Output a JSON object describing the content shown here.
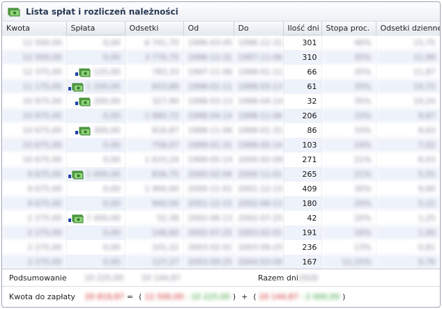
{
  "title": "Lista spłat i rozliczeń należności",
  "columns": [
    "Kwota",
    "Spłata",
    "Odsetki",
    "Od",
    "Do",
    "Ilość dni",
    "Stopa proc.",
    "Odsetki dzienne"
  ],
  "rows": [
    {
      "kwota": "12 500,00",
      "splata": "0,00",
      "payicon": false,
      "odsetki": "6 741,70",
      "od": "1996-03-05",
      "do": "1996-12-31",
      "dni": "301",
      "stopa": "46%",
      "dzienne": "15,75"
    },
    {
      "kwota": "12 500,00",
      "splata": "0,00",
      "payicon": false,
      "odsetki": "3 770,75",
      "od": "1996-12-31",
      "do": "1997-11-06",
      "dni": "310",
      "stopa": "35%",
      "dzienne": "11,99"
    },
    {
      "kwota": "12 375,00",
      "splata": "125,00",
      "payicon": true,
      "odsetki": "783,33",
      "od": "1997-11-06",
      "do": "1998-01-11",
      "dni": "66",
      "stopa": "35%",
      "dzienne": "11,87"
    },
    {
      "kwota": "11 175,00",
      "splata": "1 200,00",
      "payicon": true,
      "odsetki": "653,89",
      "od": "1998-01-11",
      "do": "1998-03-13",
      "dni": "61",
      "stopa": "35%",
      "dzienne": "10,72"
    },
    {
      "kwota": "10 975,00",
      "splata": "200,00",
      "payicon": true,
      "odsetki": "327,90",
      "od": "1998-03-13",
      "do": "1998-04-14",
      "dni": "32",
      "stopa": "35%",
      "dzienne": "10,24"
    },
    {
      "kwota": "10 975,00",
      "splata": "0,00",
      "payicon": false,
      "odsetki": "1 880,72",
      "od": "1998-04-14",
      "do": "1998-11-06",
      "dni": "206",
      "stopa": "33%",
      "dzienne": "9,87"
    },
    {
      "kwota": "10 675,00",
      "splata": "300,00",
      "payicon": true,
      "odsetki": "816,87",
      "od": "1998-11-06",
      "do": "1999-01-31",
      "dni": "86",
      "stopa": "33%",
      "dzienne": "9,63"
    },
    {
      "kwota": "10 675,00",
      "splata": "0,00",
      "payicon": false,
      "odsetki": "758,07",
      "od": "1999-01-31",
      "do": "1999-05-14",
      "dni": "103",
      "stopa": "24%",
      "dzienne": "7,02"
    },
    {
      "kwota": "10 675,00",
      "splata": "0,00",
      "payicon": false,
      "odsetki": "1 633,24",
      "od": "1999-05-14",
      "do": "2000-02-09",
      "dni": "271",
      "stopa": "21%",
      "dzienne": "6,03"
    },
    {
      "kwota": "9 675,00",
      "splata": "1 000,00",
      "payicon": true,
      "odsetki": "836,75",
      "od": "2000-02-09",
      "do": "2000-11-01",
      "dni": "265",
      "stopa": "21%",
      "dzienne": "5,55"
    },
    {
      "kwota": "9 675,00",
      "splata": "0,00",
      "payicon": false,
      "odsetki": "1 900,00",
      "od": "2000-11-01",
      "do": "2001-12-15",
      "dni": "409",
      "stopa": "30%",
      "dzienne": "9,90"
    },
    {
      "kwota": "9 675,00",
      "splata": "0,00",
      "payicon": false,
      "odsetki": "940,00",
      "od": "2001-12-15",
      "do": "2002-06-13",
      "dni": "180",
      "stopa": "20%",
      "dzienne": "5,22"
    },
    {
      "kwota": "2 275,00",
      "splata": "7 400,00",
      "payicon": true,
      "odsetki": "52,38",
      "od": "2002-06-13",
      "do": "2002-07-25",
      "dni": "42",
      "stopa": "20%",
      "dzienne": "1,25"
    },
    {
      "kwota": "2 275,00",
      "splata": "0,00",
      "payicon": false,
      "odsetki": "148,60",
      "od": "2002-07-25",
      "do": "2003-02-01",
      "dni": "191",
      "stopa": "16%",
      "dzienne": "1,00"
    },
    {
      "kwota": "2 275,00",
      "splata": "0,00",
      "payicon": false,
      "odsetki": "101,22",
      "od": "2003-02-01",
      "do": "2003-09-25",
      "dni": "236",
      "stopa": "13%",
      "dzienne": "0,81"
    },
    {
      "kwota": "2 275,00",
      "splata": "0,00",
      "payicon": false,
      "odsetki": "127,27",
      "od": "2003-09-25",
      "do": "2004-03-09",
      "dni": "167",
      "stopa": "12,25%",
      "dzienne": "0,76"
    }
  ],
  "summary": {
    "label": "Podsumowanie",
    "total_splata": "10 225,00",
    "total_odsetki": "20 144,87",
    "days_label": "Razem dni",
    "total_days": "2926"
  },
  "due": {
    "label": "Kwota do zapłaty",
    "total": "20 819,87",
    "eq": "=",
    "open1": "(",
    "a1": "12 500,00",
    "minus1": "- 10 225,00",
    "close1": ")",
    "plus": "+",
    "open2": "(",
    "a2": "20 144,87",
    "minus2": "- 2 000,00",
    "close2": ")"
  },
  "colors": {
    "header_text": "#2a3a55",
    "even_row": "#eef2fa",
    "red": "#d02020",
    "green": "#2a9a2a"
  },
  "icons": {
    "title": "money-list-icon",
    "payment": "payment-icon"
  }
}
